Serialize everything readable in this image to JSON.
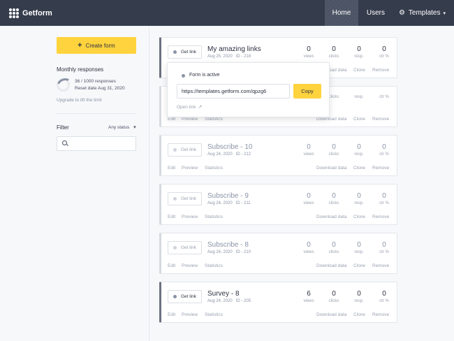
{
  "nav": {
    "brand": "Getform",
    "home": "Home",
    "users": "Users",
    "templates": "Templates"
  },
  "sidebar": {
    "create_label": "Create form",
    "monthly_title": "Monthly responses",
    "responses_text": "36 / 1000 responses",
    "reset_text": "Reset date Aug 31, 2020",
    "upgrade_text": "Upgrade to lift the limit",
    "filter_label": "Filter",
    "status_select": "Any status",
    "search_value": "",
    "search_placeholder": ""
  },
  "card_labels": {
    "get_link": "Get link",
    "views": "views",
    "clicks": "clicks",
    "resp": "resp.",
    "ctr": "ctr %",
    "edit": "Edit",
    "preview": "Preview",
    "statistics": "Statistics",
    "download": "Download data",
    "clone": "Clone",
    "remove": "Remove"
  },
  "forms": [
    {
      "name": "My amazing links",
      "date": "Aug 25, 2020",
      "id": "ID - 218",
      "views": "0",
      "clicks": "0",
      "resp": "0",
      "ctr": "0",
      "active": true
    },
    {
      "name": "",
      "date": "",
      "id": "",
      "views": "",
      "clicks": "",
      "resp": "",
      "ctr": "",
      "active": false
    },
    {
      "name": "Subscribe - 10",
      "date": "Aug 24, 2020",
      "id": "ID - 212",
      "views": "0",
      "clicks": "0",
      "resp": "0",
      "ctr": "0",
      "active": false
    },
    {
      "name": "Subscribe - 9",
      "date": "Aug 24, 2020",
      "id": "ID - 211",
      "views": "0",
      "clicks": "0",
      "resp": "0",
      "ctr": "0",
      "active": false
    },
    {
      "name": "Subscribe - 8",
      "date": "Aug 24, 2020",
      "id": "ID - 210",
      "views": "0",
      "clicks": "0",
      "resp": "0",
      "ctr": "0",
      "active": false
    },
    {
      "name": "Survey - 8",
      "date": "Aug 24, 2020",
      "id": "ID - 205",
      "views": "6",
      "clicks": "0",
      "resp": "0",
      "ctr": "0",
      "active": true
    }
  ],
  "popup": {
    "status": "Form is active",
    "url": "https://templates.getform.com/qpzg6",
    "copy_label": "Copy",
    "open_link": "Open link"
  },
  "colors": {
    "navbar": "#353c4c",
    "accent_yellow": "#ffd33d"
  }
}
